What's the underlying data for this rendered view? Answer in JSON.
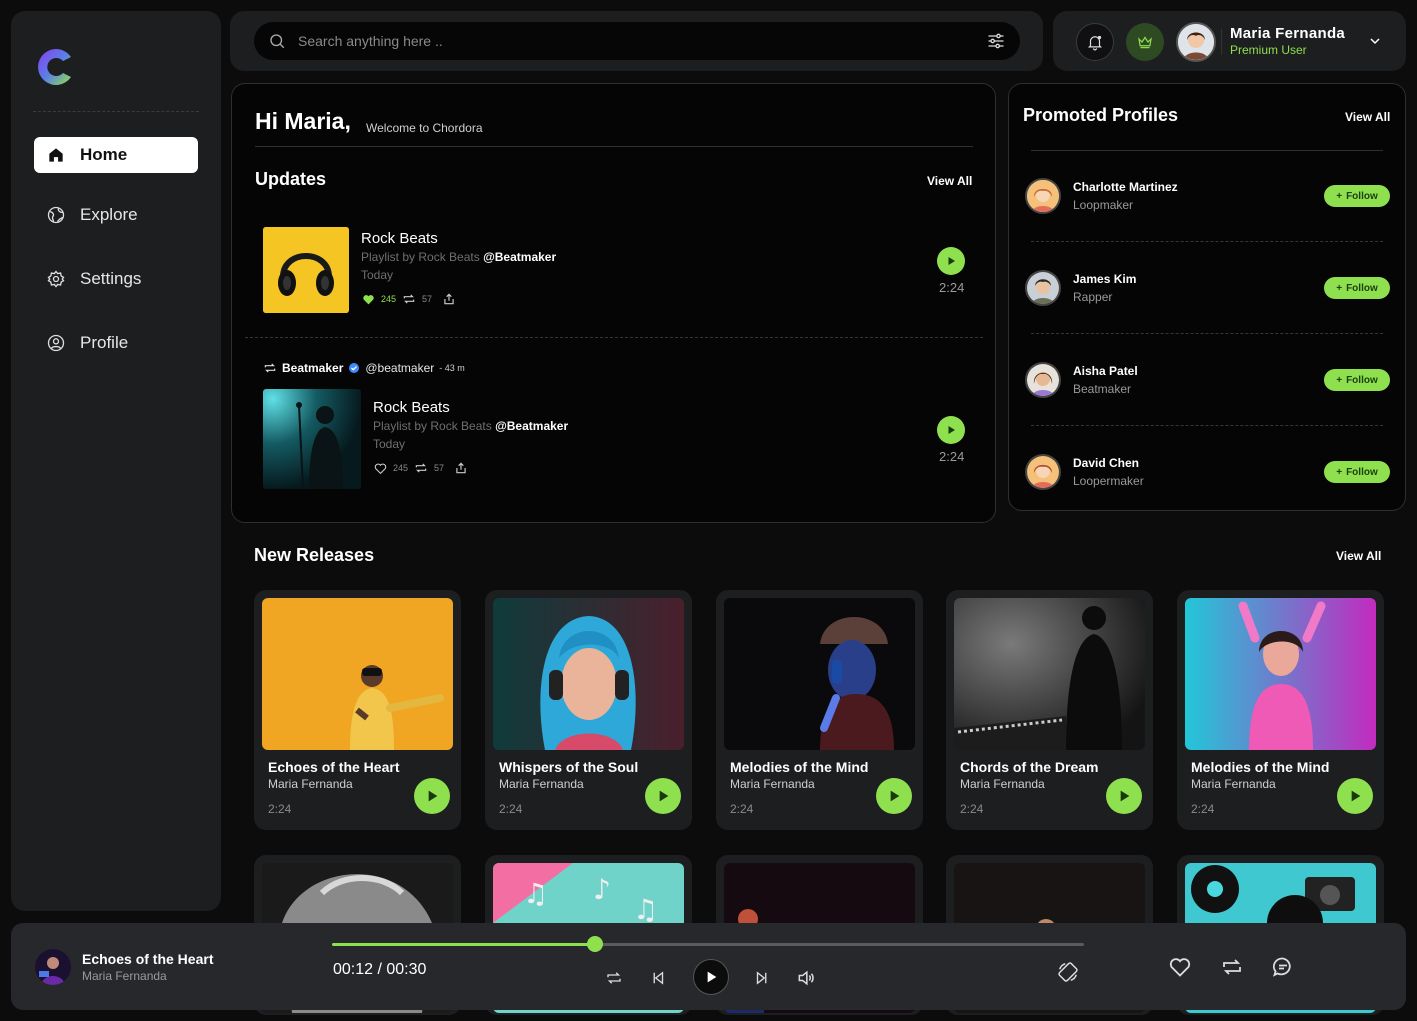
{
  "colors": {
    "accent": "#8fe04f",
    "panel": "#1d1e20",
    "background": "#0c0c0d"
  },
  "sidebar": {
    "items": [
      {
        "label": "Home",
        "icon": "home-icon",
        "active": true
      },
      {
        "label": "Explore",
        "icon": "globe-icon"
      },
      {
        "label": "Settings",
        "icon": "gear-icon"
      },
      {
        "label": "Profile",
        "icon": "user-circle-icon"
      }
    ]
  },
  "search": {
    "placeholder": "Search anything here .."
  },
  "user": {
    "name": "Maria Fernanda",
    "role": "Premium User"
  },
  "greeting": {
    "title": "Hi Maria,",
    "subtitle": "Welcome to Chordora"
  },
  "updates": {
    "title": "Updates",
    "view_all": "View All",
    "items": [
      {
        "title": "Rock Beats",
        "by_prefix": "Playlist by Rock Beats",
        "by_handle": "@Beatmaker",
        "when": "Today",
        "likes": "245",
        "reposts": "57",
        "duration": "2:24"
      },
      {
        "title": "Rock Beats",
        "by_prefix": "Playlist by Rock Beats",
        "by_handle": "@Beatmaker",
        "when": "Today",
        "likes": "245",
        "reposts": "57",
        "duration": "2:24"
      }
    ],
    "repost": {
      "name": "Beatmaker",
      "handle": "@beatmaker",
      "ago": "- 43 m"
    }
  },
  "promoted": {
    "title": "Promoted Profiles",
    "view_all": "View All",
    "follow_label": "Follow",
    "profiles": [
      {
        "name": "Charlotte Martinez",
        "role": "Loopmaker"
      },
      {
        "name": "James Kim",
        "role": "Rapper"
      },
      {
        "name": "Aisha Patel",
        "role": "Beatmaker"
      },
      {
        "name": "David Chen",
        "role": "Loopermaker"
      }
    ]
  },
  "releases": {
    "title": "New Releases",
    "view_all": "View All",
    "items": [
      {
        "title": "Echoes of the Heart",
        "artist": "Maria Fernanda",
        "duration": "2:24"
      },
      {
        "title": "Whispers of the Soul",
        "artist": "Maria Fernanda",
        "duration": "2:24"
      },
      {
        "title": "Melodies of the Mind",
        "artist": "Maria Fernanda",
        "duration": "2:24"
      },
      {
        "title": "Chords of the Dream",
        "artist": "Maria Fernanda",
        "duration": "2:24"
      },
      {
        "title": "Melodies of the Mind",
        "artist": "Maria Fernanda",
        "duration": "2:24"
      }
    ]
  },
  "player": {
    "title": "Echoes of the Heart",
    "artist": "Maria Fernanda",
    "time": "00:12 / 00:30",
    "progress": 0.35
  }
}
